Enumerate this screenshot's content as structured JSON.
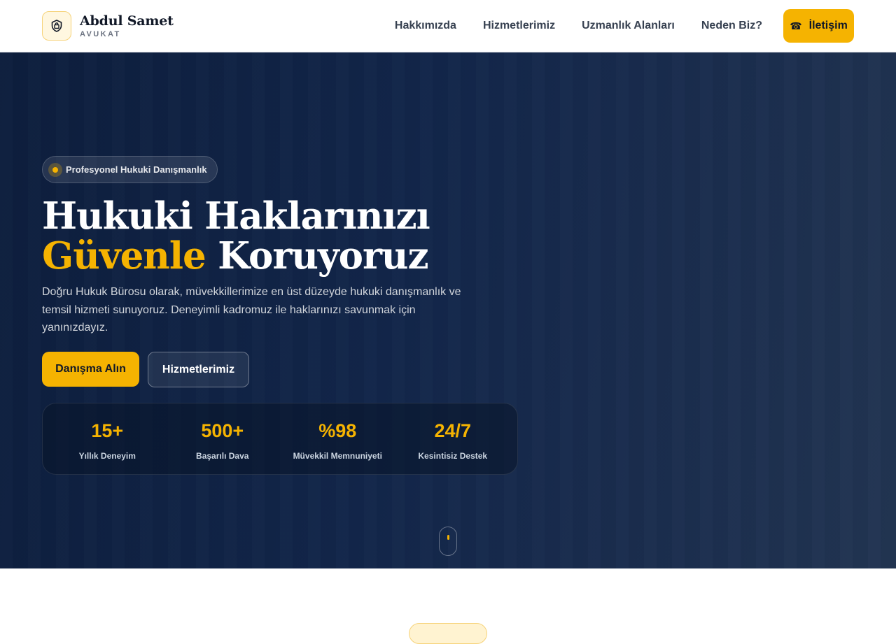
{
  "brand": {
    "name": "Abdul Samet",
    "subtitle": "AVUKAT",
    "logo_icon": "shield-icon"
  },
  "nav": {
    "items": [
      {
        "label": "Hakkımızda"
      },
      {
        "label": "Hizmetlerimiz"
      },
      {
        "label": "Uzmanlık Alanları"
      },
      {
        "label": "Neden Biz?"
      }
    ],
    "cta": {
      "label": "İletişim",
      "icon": "phone-icon"
    }
  },
  "hero": {
    "badge": "Profesyonel Hukuki Danışmanlık",
    "title_line1": "Hukuki Haklarınızı",
    "title_accent": "Güvenle",
    "title_rest": " Koruyoruz",
    "description": "Doğru Hukuk Bürosu olarak, müvekkillerimize en üst düzeyde hukuki danışmanlık ve temsil hizmeti sunuyoruz. Deneyimli kadromuz ile haklarınızı savunmak için yanınızdayız.",
    "primary_button": "Danışma Alın",
    "secondary_button": "Hizmetlerimiz"
  },
  "stats": [
    {
      "value": "15+",
      "label": "Yıllık Deneyim"
    },
    {
      "value": "500+",
      "label": "Başarılı Dava"
    },
    {
      "value": "%98",
      "label": "Müvekkil Memnuniyeti"
    },
    {
      "value": "24/7",
      "label": "Kesintisiz Destek"
    }
  ],
  "colors": {
    "accent": "#f5b301",
    "hero_bg": "#12264a",
    "text_dark": "#111827"
  }
}
